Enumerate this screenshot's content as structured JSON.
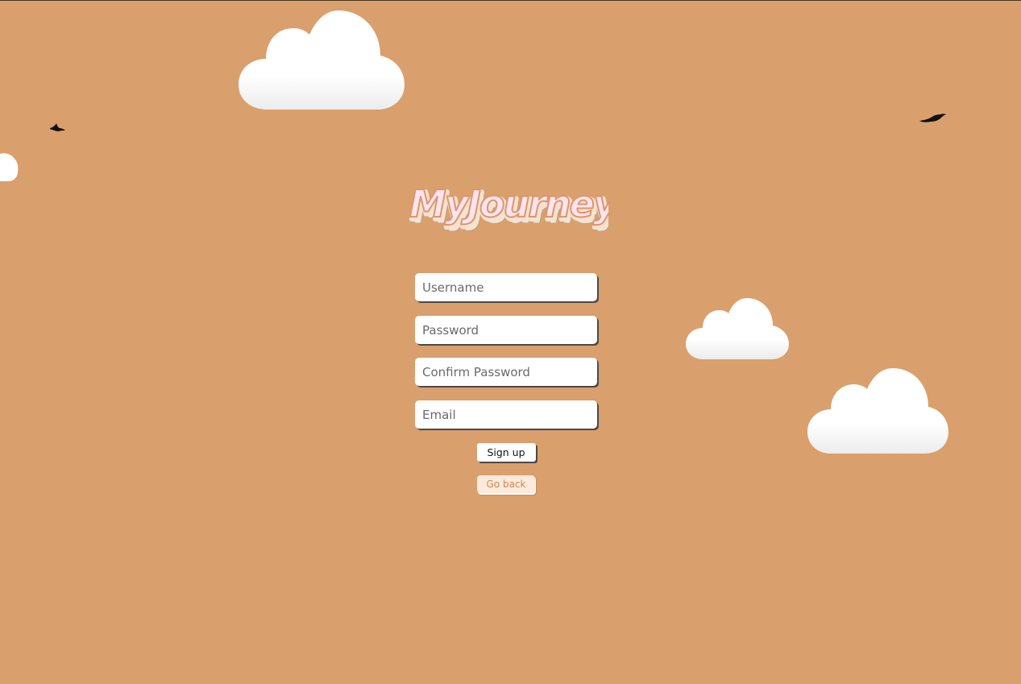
{
  "app": {
    "logo_text": "MyJourney"
  },
  "form": {
    "username_placeholder": "Username",
    "password_placeholder": "Password",
    "confirm_password_placeholder": "Confirm Password",
    "email_placeholder": "Email",
    "signup_label": "Sign up",
    "goback_label": "Go back"
  },
  "colors": {
    "background": "#d99f6c",
    "accent": "#d2874a",
    "cloud": "#ffffff",
    "logo_fill": "#fde4f0",
    "logo_outline": "#e0956a"
  },
  "decorations": {
    "clouds": [
      "cloud-icon",
      "cloud-icon",
      "cloud-icon",
      "cloud-icon"
    ],
    "birds": [
      "bird-icon",
      "bird-icon"
    ]
  }
}
